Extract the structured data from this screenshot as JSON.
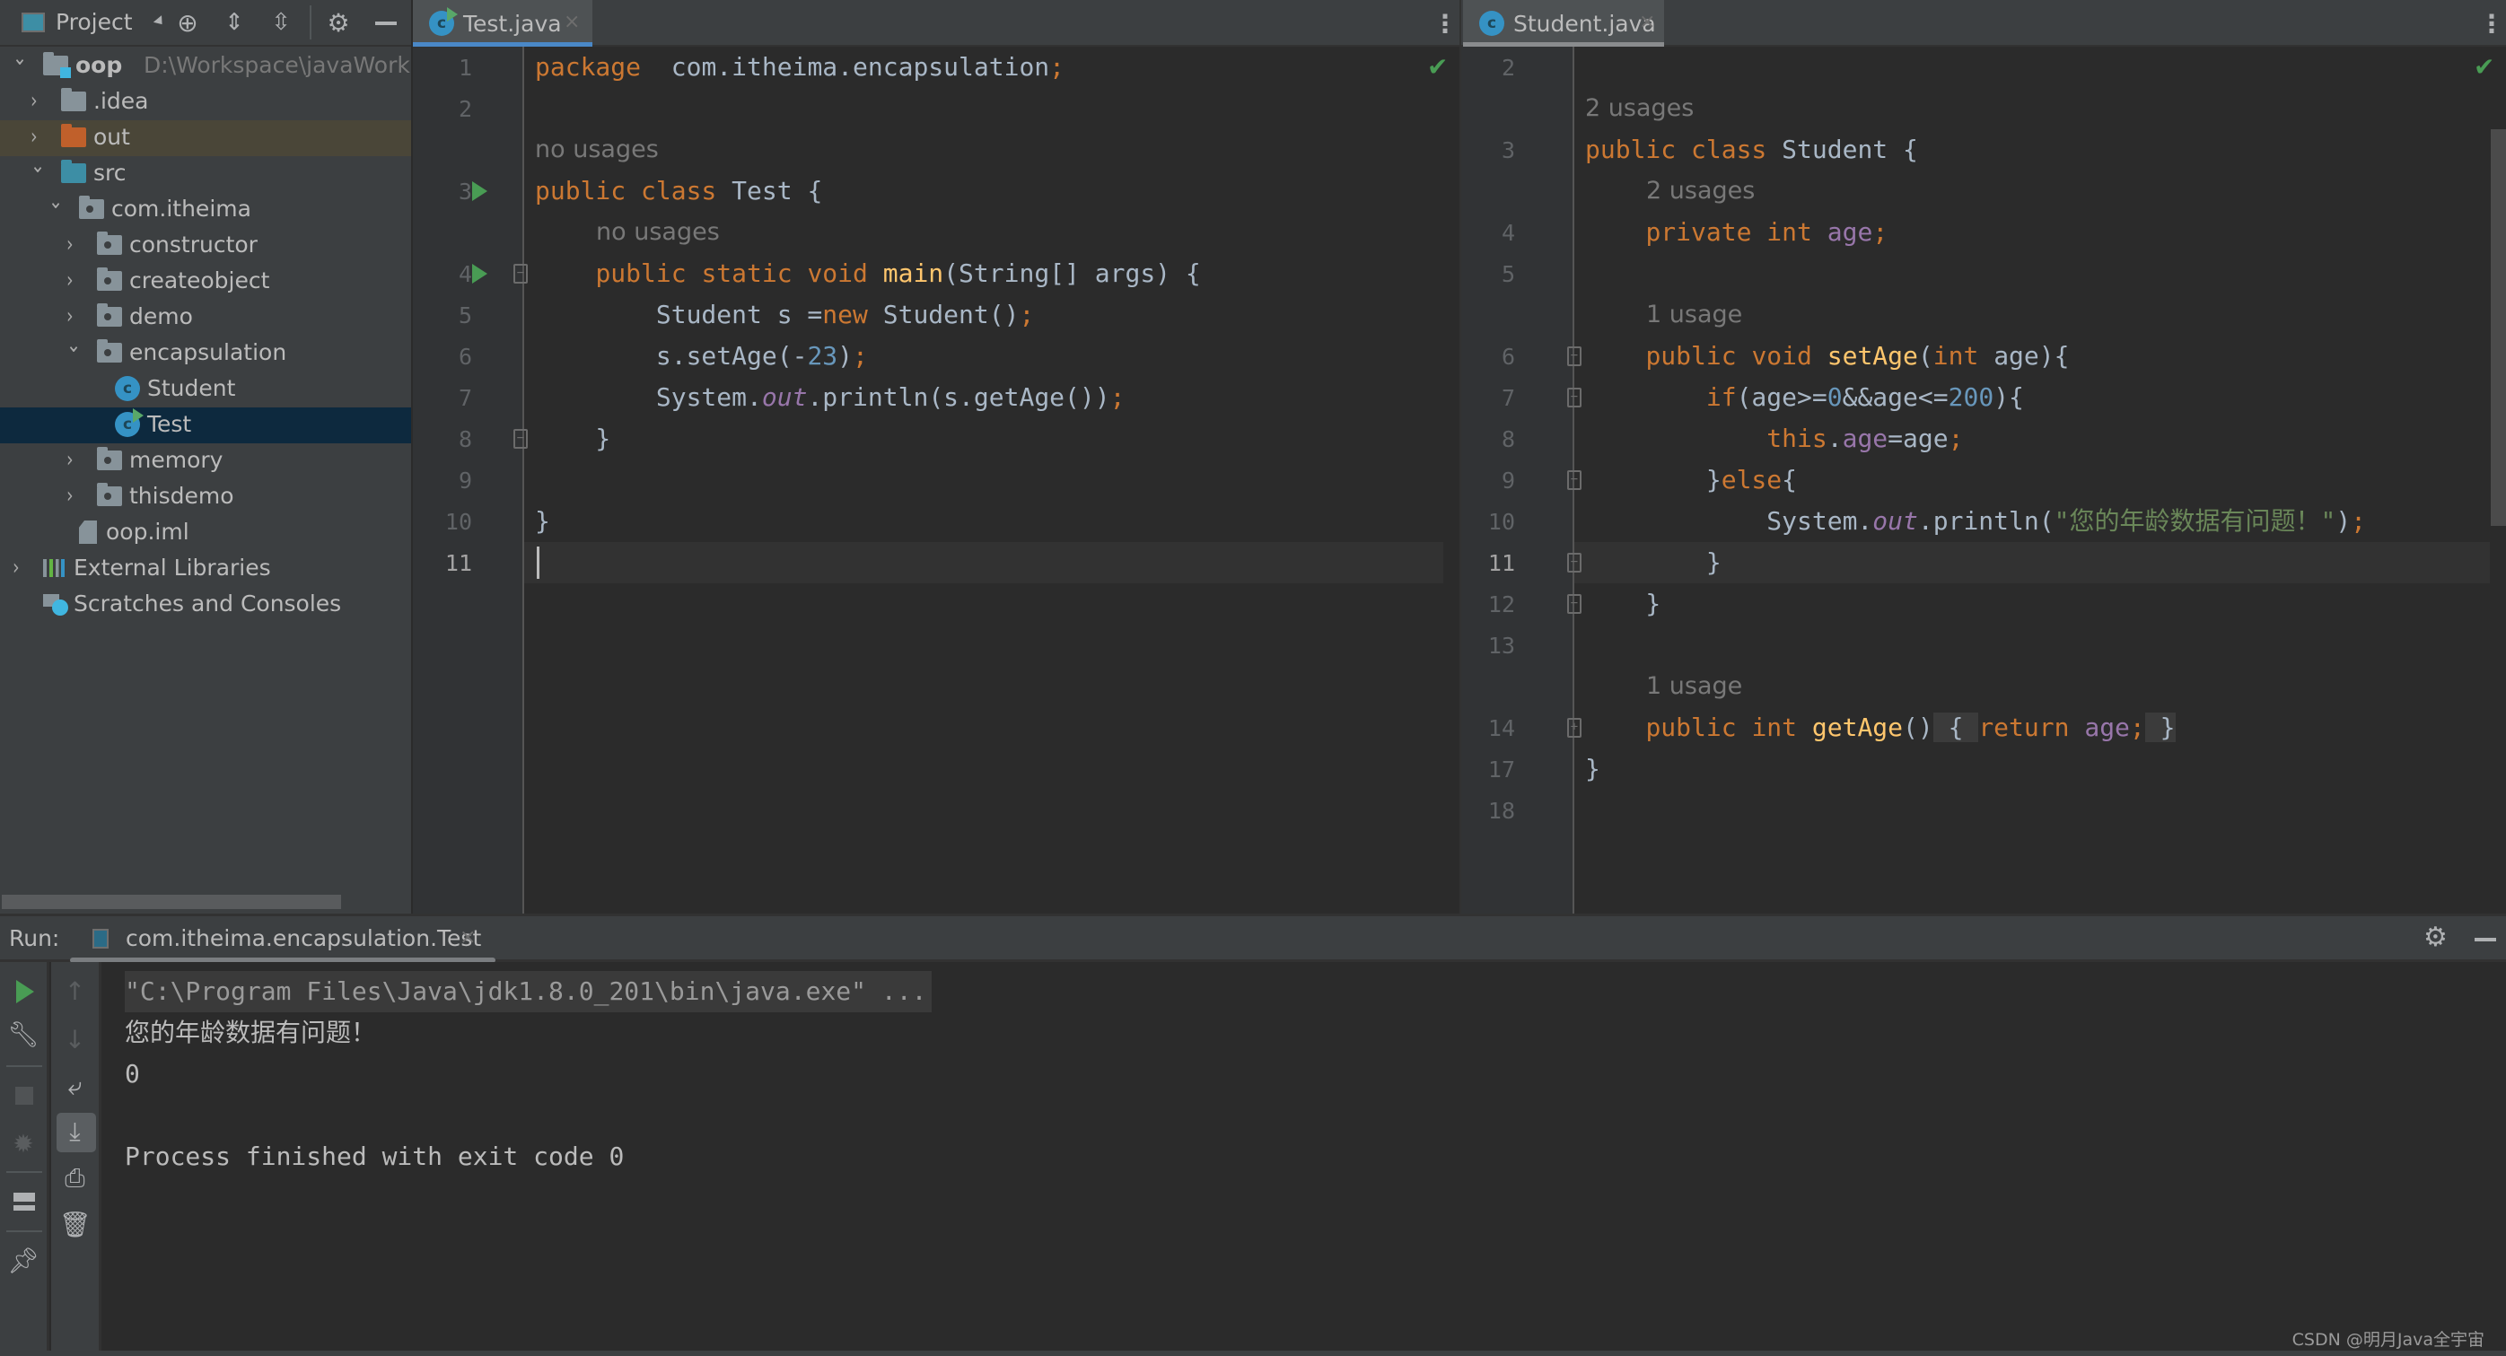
{
  "project_panel": {
    "title": "Project",
    "toolbar_icons": [
      "locate-icon",
      "expand-all-icon",
      "collapse-all-icon",
      "gear-icon",
      "minimize-icon"
    ],
    "tree": [
      {
        "label": "oop",
        "path": "D:\\Workspace\\javaWorkspa",
        "type": "module",
        "expanded": true,
        "depth": 0
      },
      {
        "label": ".idea",
        "type": "folder",
        "expanded": false,
        "depth": 1
      },
      {
        "label": "out",
        "type": "folder-excluded",
        "expanded": false,
        "depth": 1
      },
      {
        "label": "src",
        "type": "folder-source",
        "expanded": true,
        "depth": 1
      },
      {
        "label": "com.itheima",
        "type": "package",
        "expanded": true,
        "depth": 2
      },
      {
        "label": "constructor",
        "type": "package",
        "expanded": false,
        "depth": 3
      },
      {
        "label": "createobject",
        "type": "package",
        "expanded": false,
        "depth": 3
      },
      {
        "label": "demo",
        "type": "package",
        "expanded": false,
        "depth": 3
      },
      {
        "label": "encapsulation",
        "type": "package",
        "expanded": true,
        "depth": 3
      },
      {
        "label": "Student",
        "type": "class",
        "depth": 4
      },
      {
        "label": "Test",
        "type": "class-runnable",
        "depth": 4,
        "selected": true
      },
      {
        "label": "memory",
        "type": "package",
        "expanded": false,
        "depth": 3
      },
      {
        "label": "thisdemo",
        "type": "package",
        "expanded": false,
        "depth": 3
      },
      {
        "label": "oop.iml",
        "type": "iml-file",
        "depth": 2
      },
      {
        "label": "External Libraries",
        "type": "libraries",
        "expanded": false,
        "depth": 0
      },
      {
        "label": "Scratches and Consoles",
        "type": "scratches",
        "depth": 0
      }
    ]
  },
  "left_editor": {
    "tab": {
      "label": "Test.java",
      "close": "×",
      "active": true
    },
    "status": "no-problems",
    "lines": [
      {
        "num": "1",
        "kind": "code",
        "html_tokens": [
          [
            "kw",
            "package"
          ],
          [
            "",
            "  com.itheima.encapsulation"
          ],
          [
            "semi",
            ";"
          ]
        ]
      },
      {
        "num": "2",
        "kind": "code",
        "html_tokens": []
      },
      {
        "num": "",
        "kind": "hint",
        "text": "no usages",
        "indent": 0
      },
      {
        "num": "3",
        "kind": "code",
        "run": true,
        "html_tokens": [
          [
            "kw",
            "public class "
          ],
          [
            "",
            "Test {"
          ]
        ]
      },
      {
        "num": "",
        "kind": "hint",
        "text": "no usages",
        "indent": 4
      },
      {
        "num": "4",
        "kind": "code",
        "run": true,
        "fold": "open",
        "html_tokens": [
          [
            "",
            "    "
          ],
          [
            "kw",
            "public static void "
          ],
          [
            "fn",
            "main"
          ],
          [
            "",
            "(String[] args) {"
          ]
        ]
      },
      {
        "num": "5",
        "kind": "code",
        "html_tokens": [
          [
            "",
            "        Student s ="
          ],
          [
            "kw",
            "new "
          ],
          [
            "",
            "Student()"
          ],
          [
            "semi",
            ";"
          ]
        ]
      },
      {
        "num": "6",
        "kind": "code",
        "html_tokens": [
          [
            "",
            "        s.setAge(-"
          ],
          [
            "num",
            "23"
          ],
          [
            "",
            ")"
          ],
          [
            "semi",
            ";"
          ]
        ]
      },
      {
        "num": "7",
        "kind": "code",
        "html_tokens": [
          [
            "",
            "        System."
          ],
          [
            "stat",
            "out"
          ],
          [
            "",
            ".println(s.getAge())"
          ],
          [
            "semi",
            ";"
          ]
        ]
      },
      {
        "num": "8",
        "kind": "code",
        "fold": "close",
        "html_tokens": [
          [
            "",
            "    }"
          ]
        ]
      },
      {
        "num": "9",
        "kind": "code",
        "html_tokens": []
      },
      {
        "num": "10",
        "kind": "code",
        "html_tokens": [
          [
            "",
            "}"
          ]
        ]
      },
      {
        "num": "11",
        "kind": "code",
        "current": true,
        "html_tokens": []
      }
    ]
  },
  "right_editor": {
    "tab": {
      "label": "Student.java",
      "close": "×",
      "active": false
    },
    "status": "no-problems",
    "lines": [
      {
        "num": "2",
        "kind": "code",
        "html_tokens": []
      },
      {
        "num": "",
        "kind": "hint",
        "text": "2 usages",
        "indent": 0
      },
      {
        "num": "3",
        "kind": "code",
        "html_tokens": [
          [
            "kw",
            "public class "
          ],
          [
            "",
            "Student {"
          ]
        ]
      },
      {
        "num": "",
        "kind": "hint",
        "text": "2 usages",
        "indent": 4
      },
      {
        "num": "4",
        "kind": "code",
        "html_tokens": [
          [
            "",
            "    "
          ],
          [
            "kw",
            "private int "
          ],
          [
            "fld",
            "age"
          ],
          [
            "semi",
            ";"
          ]
        ]
      },
      {
        "num": "5",
        "kind": "code",
        "html_tokens": []
      },
      {
        "num": "",
        "kind": "hint",
        "text": "1 usage",
        "indent": 4
      },
      {
        "num": "6",
        "kind": "code",
        "fold": "open",
        "html_tokens": [
          [
            "",
            "    "
          ],
          [
            "kw",
            "public void "
          ],
          [
            "fn",
            "setAge"
          ],
          [
            "",
            "("
          ],
          [
            "kw",
            "int "
          ],
          [
            "",
            "age){"
          ]
        ]
      },
      {
        "num": "7",
        "kind": "code",
        "fold": "open",
        "html_tokens": [
          [
            "",
            "        "
          ],
          [
            "kw",
            "if"
          ],
          [
            "",
            "(age>="
          ],
          [
            "num",
            "0"
          ],
          [
            "",
            "&&age<="
          ],
          [
            "num",
            "200"
          ],
          [
            "",
            "){"
          ]
        ]
      },
      {
        "num": "8",
        "kind": "code",
        "html_tokens": [
          [
            "",
            "            "
          ],
          [
            "kw",
            "this"
          ],
          [
            "",
            "."
          ],
          [
            "fld",
            "age"
          ],
          [
            "",
            "=age"
          ],
          [
            "semi",
            ";"
          ]
        ]
      },
      {
        "num": "9",
        "kind": "code",
        "fold": "close",
        "html_tokens": [
          [
            "",
            "        }"
          ],
          [
            "kw",
            "else"
          ],
          [
            "",
            "{"
          ]
        ]
      },
      {
        "num": "10",
        "kind": "code",
        "html_tokens": [
          [
            "",
            "            System."
          ],
          [
            "stat",
            "out"
          ],
          [
            "",
            ".println("
          ],
          [
            "str",
            "\"您的年龄数据有问题！\""
          ],
          [
            "",
            ")"
          ],
          [
            "semi",
            ";"
          ]
        ]
      },
      {
        "num": "11",
        "kind": "code",
        "current": true,
        "fold": "close",
        "html_tokens": [
          [
            "",
            "        }"
          ]
        ]
      },
      {
        "num": "12",
        "kind": "code",
        "fold": "close",
        "html_tokens": [
          [
            "",
            "    }"
          ]
        ]
      },
      {
        "num": "13",
        "kind": "code",
        "html_tokens": []
      },
      {
        "num": "",
        "kind": "hint",
        "text": "1 usage",
        "indent": 4
      },
      {
        "num": "14",
        "kind": "code",
        "fold": "collapsed",
        "html_tokens": [
          [
            "",
            "    "
          ],
          [
            "kw",
            "public int "
          ],
          [
            "fn",
            "getAge"
          ],
          [
            "",
            "()"
          ],
          [
            "fold-bg",
            " { "
          ],
          [
            "kw",
            "return "
          ],
          [
            "fld",
            "age"
          ],
          [
            "semi",
            ";"
          ],
          [
            "fold-bg",
            " }"
          ]
        ]
      },
      {
        "num": "17",
        "kind": "code",
        "html_tokens": [
          [
            "",
            "}"
          ]
        ]
      },
      {
        "num": "18",
        "kind": "code",
        "html_tokens": []
      }
    ]
  },
  "run_panel": {
    "label": "Run:",
    "tab_label": "com.itheima.encapsulation.Test",
    "tab_close": "×",
    "left_tools": [
      "rerun-icon",
      "edit-config-icon",
      "stop-icon",
      "debug-attach-icon",
      "layout-icon",
      "pin-icon"
    ],
    "right_tools": [
      "scroll-up-icon",
      "scroll-down-icon",
      "soft-wrap-icon",
      "scroll-to-end-icon",
      "print-icon",
      "clear-icon"
    ],
    "console": [
      {
        "text": "\"C:\\Program Files\\Java\\jdk1.8.0_201\\bin\\java.exe\" ...",
        "kind": "cmd"
      },
      {
        "text": "您的年龄数据有问题！",
        "kind": "out"
      },
      {
        "text": "0",
        "kind": "out"
      },
      {
        "text": "",
        "kind": "out"
      },
      {
        "text": "Process finished with exit code 0",
        "kind": "out"
      }
    ]
  },
  "watermark": "CSDN @明月Java全宇宙",
  "colors": {
    "accent_tab_underline": "#4a88c7",
    "inactive_tab_underline": "#8a8c8e",
    "run_green": "#499c54",
    "keyword": "#cc7832",
    "function": "#ffc66d",
    "number": "#6897bb",
    "field": "#9876aa",
    "string": "#6a8759"
  }
}
